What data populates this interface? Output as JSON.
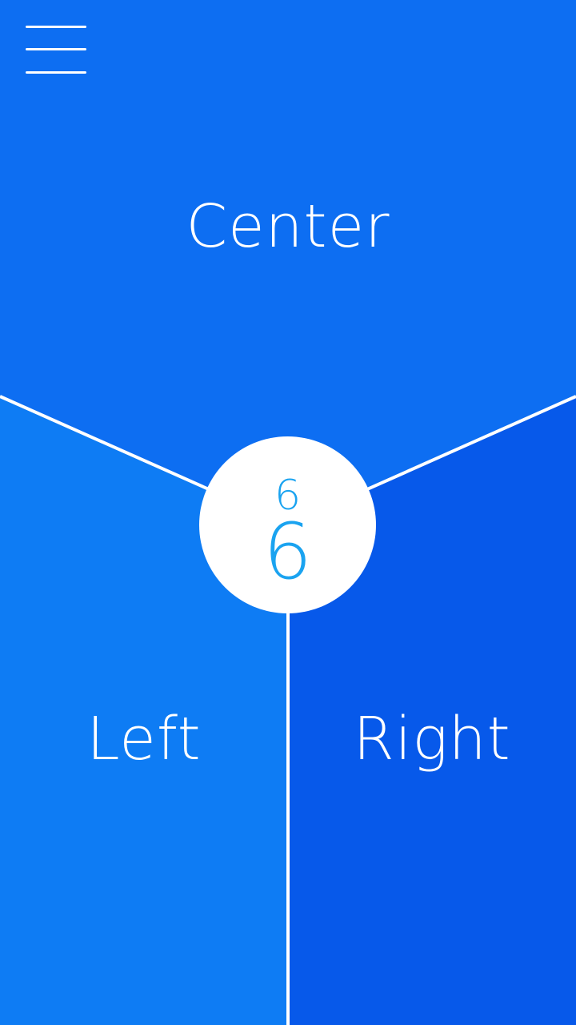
{
  "menu": {
    "icon": "hamburger-menu-icon"
  },
  "zones": {
    "center": {
      "label": "Center",
      "color": "#0d6ef2"
    },
    "left": {
      "label": "Left",
      "color": "#0e7cf4"
    },
    "right": {
      "label": "Right",
      "color": "#0759ea"
    }
  },
  "divider_color": "#ffffff",
  "score": {
    "small": "6",
    "large": "6",
    "text_color": "#1aa3f0",
    "background": "#ffffff"
  }
}
